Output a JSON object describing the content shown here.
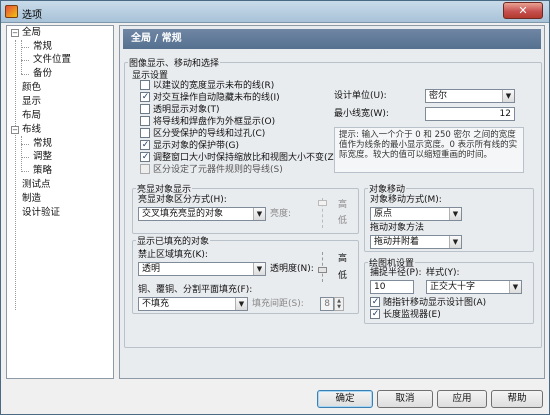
{
  "window": {
    "title": "选项",
    "close_label": "✕"
  },
  "tree": {
    "items": [
      {
        "label": "全局",
        "level": 0,
        "toggle": "−"
      },
      {
        "label": "常规",
        "level": 1
      },
      {
        "label": "文件位置",
        "level": 1
      },
      {
        "label": "备份",
        "level": 1
      },
      {
        "label": "颜色",
        "level": 0
      },
      {
        "label": "显示",
        "level": 0
      },
      {
        "label": "布局",
        "level": 0
      },
      {
        "label": "布线",
        "level": 0,
        "toggle": "−"
      },
      {
        "label": "常规",
        "level": 1
      },
      {
        "label": "调整",
        "level": 1
      },
      {
        "label": "策略",
        "level": 1
      },
      {
        "label": "测试点",
        "level": 0
      },
      {
        "label": "制造",
        "level": 0
      },
      {
        "label": "设计验证",
        "level": 0
      }
    ]
  },
  "header": {
    "title": "全局 / 常规"
  },
  "image_display": {
    "section_title": "图像显示、移动和选择",
    "display_settings_title": "显示设置",
    "checkboxes": [
      {
        "label": "以建议的宽度显示未布的线(R)",
        "checked": false
      },
      {
        "label": "对交互操作自动隐藏未布的线(I)",
        "checked": true
      },
      {
        "label": "透明显示对象(T)",
        "checked": false
      },
      {
        "label": "将导线和焊盘作为外框显示(O)",
        "checked": false
      },
      {
        "label": "区分受保护的导线和过孔(C)",
        "checked": false
      },
      {
        "label": "显示对象的保护带(G)",
        "checked": true
      },
      {
        "label": "调整窗口大小时保持缩放比和视图大小不变(Z)",
        "checked": true
      },
      {
        "label": "区分设定了元器件规则的导线(S)",
        "checked": false,
        "disabled": true
      }
    ],
    "design_units_label": "设计单位(U):",
    "design_units_value": "密尔",
    "min_width_label": "最小线宽(W):",
    "min_width_value": "12",
    "hint_text": "提示: 输入一个介于 0 和 250 密尔 之间的宽度值作为线条的最小显示宽度。0 表示所有线的实际宽度。较大的值可以缩短重画的时间。"
  },
  "highlight": {
    "title": "亮显对象显示",
    "mode_label": "亮显对象区分方式(H):",
    "mode_value": "交叉填充亮显的对象",
    "brightness_label": "亮度:",
    "high_label": "高",
    "low_label": "低"
  },
  "filled_objects": {
    "title": "显示已填充的对象",
    "fill_label": "禁止区域填充(K):",
    "fill_value": "透明",
    "transparency_label": "透明度(N):",
    "high_label": "高",
    "low_label": "低",
    "copper_label": "铜、覆铜、分割平面填充(F):",
    "copper_value": "不填充",
    "spacing_label": "填充间距(S):",
    "spacing_value": "8"
  },
  "object_move": {
    "title": "对象移动",
    "move_label": "对象移动方式(M):",
    "move_value": "原点",
    "drag_label": "拖动对象方法",
    "drag_value": "拖动并附着"
  },
  "drawing": {
    "title": "绘图机设置",
    "radius_label": "捕捉半径(P):",
    "radius_value": "10",
    "style_label": "样式(Y):",
    "style_value": "正交大十字",
    "checkboxes": [
      {
        "label": "随指针移动显示设计图(A)",
        "checked": true
      },
      {
        "label": "长度监视器(E)",
        "checked": true
      }
    ]
  },
  "buttons": {
    "ok": "确定",
    "cancel": "取消",
    "apply": "应用",
    "help": "帮助"
  }
}
